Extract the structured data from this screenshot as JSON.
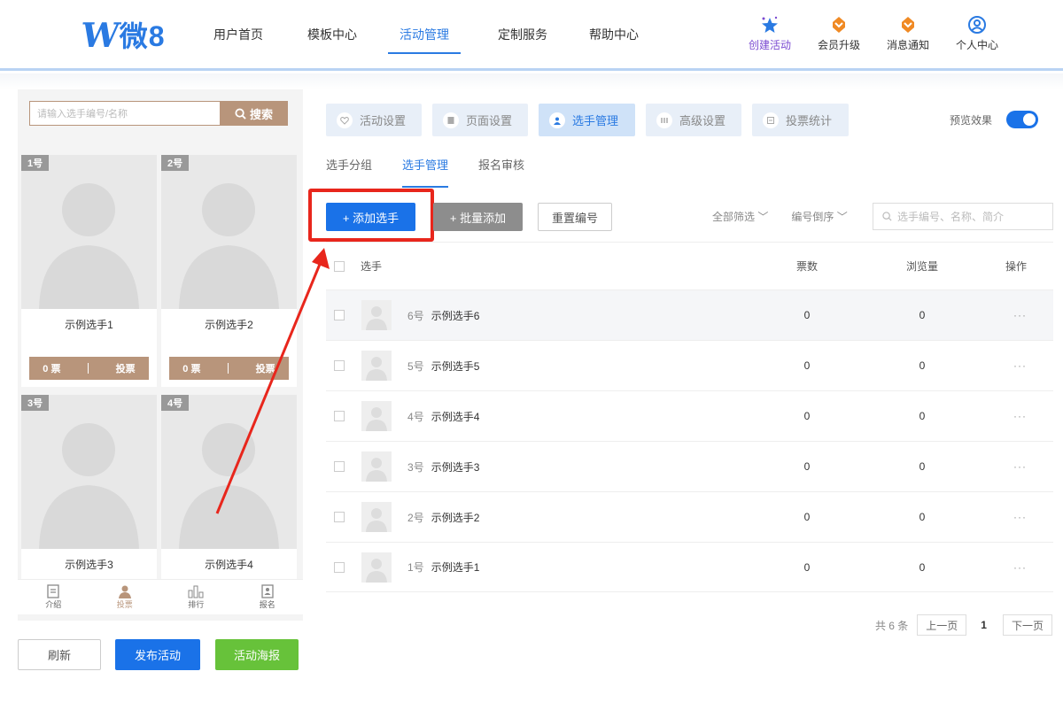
{
  "brand": {
    "logo_text": "微8"
  },
  "nav": {
    "items": [
      {
        "label": "用户首页",
        "active": false
      },
      {
        "label": "模板中心",
        "active": false
      },
      {
        "label": "活动管理",
        "active": true
      },
      {
        "label": "定制服务",
        "active": false
      },
      {
        "label": "帮助中心",
        "active": false
      }
    ],
    "icons": [
      {
        "label": "创建活动",
        "icon": "star-sparkle-icon"
      },
      {
        "label": "会员升级",
        "icon": "diamond-badge-icon"
      },
      {
        "label": "消息通知",
        "icon": "bell-badge-icon"
      },
      {
        "label": "个人中心",
        "icon": "user-circle-icon"
      }
    ]
  },
  "preview_panel": {
    "search_placeholder": "请输入选手编号/名称",
    "search_button": "搜索",
    "cards": [
      {
        "num": "1号",
        "name": "示例选手1",
        "votes": "0 票",
        "vote_btn": "投票"
      },
      {
        "num": "2号",
        "name": "示例选手2",
        "votes": "0 票",
        "vote_btn": "投票"
      },
      {
        "num": "3号",
        "name": "示例选手3"
      },
      {
        "num": "4号",
        "name": "示例选手4"
      }
    ],
    "bottom_tabs": [
      {
        "label": "介绍",
        "icon": "document-icon"
      },
      {
        "label": "投票",
        "icon": "person-icon",
        "active": true
      },
      {
        "label": "排行",
        "icon": "bar-chart-icon"
      },
      {
        "label": "报名",
        "icon": "signup-form-icon"
      }
    ],
    "actions": {
      "refresh": "刷新",
      "publish": "发布活动",
      "poster": "活动海报"
    }
  },
  "setting_tabs": [
    {
      "label": "活动设置",
      "icon": "heart-icon"
    },
    {
      "label": "页面设置",
      "icon": "page-icon"
    },
    {
      "label": "选手管理",
      "icon": "player-icon",
      "active": true
    },
    {
      "label": "高级设置",
      "icon": "advanced-icon"
    },
    {
      "label": "投票统计",
      "icon": "stats-icon"
    }
  ],
  "preview_toggle": {
    "label": "预览效果",
    "on": true
  },
  "sub_tabs": [
    {
      "label": "选手分组"
    },
    {
      "label": "选手管理",
      "active": true
    },
    {
      "label": "报名审核"
    }
  ],
  "toolbar": {
    "add": "+ 添加选手",
    "batch_add": "+ 批量添加",
    "reset_num": "重置编号",
    "filter_all": "全部筛选",
    "sort": "编号倒序",
    "search_placeholder": "选手编号、名称、简介"
  },
  "table": {
    "headers": {
      "player": "选手",
      "votes": "票数",
      "views": "浏览量",
      "ops": "操作"
    },
    "rows": [
      {
        "num": "6号",
        "name": "示例选手6",
        "votes": "0",
        "views": "0",
        "ops": "···"
      },
      {
        "num": "5号",
        "name": "示例选手5",
        "votes": "0",
        "views": "0",
        "ops": "···"
      },
      {
        "num": "4号",
        "name": "示例选手4",
        "votes": "0",
        "views": "0",
        "ops": "···"
      },
      {
        "num": "3号",
        "name": "示例选手3",
        "votes": "0",
        "views": "0",
        "ops": "···"
      },
      {
        "num": "2号",
        "name": "示例选手2",
        "votes": "0",
        "views": "0",
        "ops": "···"
      },
      {
        "num": "1号",
        "name": "示例选手1",
        "votes": "0",
        "views": "0",
        "ops": "···"
      }
    ]
  },
  "pager": {
    "total": "共 6 条",
    "prev": "上一页",
    "current": "1",
    "next": "下一页"
  },
  "colors": {
    "accent": "#1a72e8",
    "brand_brown": "#b8957b",
    "green": "#67c23a",
    "highlight": "#e8261c"
  }
}
